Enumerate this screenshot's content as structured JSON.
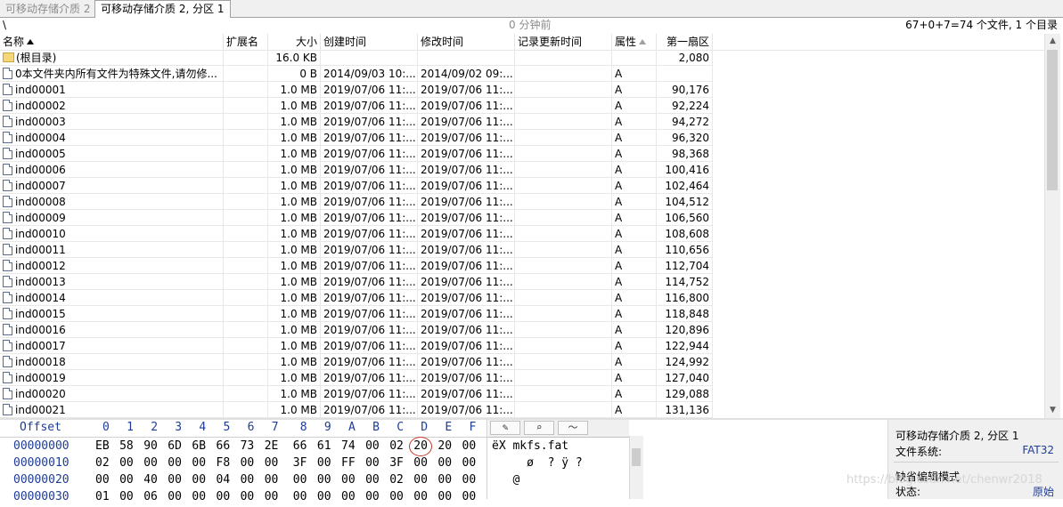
{
  "tabs": [
    {
      "label": "可移动存储介质 2",
      "active": false
    },
    {
      "label": "可移动存储介质 2, 分区 1",
      "active": true
    }
  ],
  "status": {
    "path": "\\",
    "elapsed": "0 分钟前",
    "counts": "67+0+7=74 个文件, 1 个目录"
  },
  "columns": {
    "name": "名称",
    "ext": "扩展名",
    "size": "大小",
    "created": "创建时间",
    "modified": "修改时间",
    "record_updated": "记录更新时间",
    "attr": "属性",
    "first_sector": "第一扇区"
  },
  "files": [
    {
      "type": "dir",
      "name": "(根目录)",
      "ext": "",
      "size": "16.0 KB",
      "created": "",
      "modified": "",
      "record_updated": "",
      "attr": "",
      "first_sector": "2,080"
    },
    {
      "type": "file",
      "name": "0本文件夹内所有文件为特殊文件,请勿修...",
      "ext": "",
      "size": "0 B",
      "created": "2014/09/03   10:...",
      "modified": "2014/09/02   09:...",
      "record_updated": "",
      "attr": "A",
      "first_sector": ""
    },
    {
      "type": "file",
      "name": "ind00001",
      "ext": "",
      "size": "1.0 MB",
      "created": "2019/07/06   11:...",
      "modified": "2019/07/06   11:...",
      "record_updated": "",
      "attr": "A",
      "first_sector": "90,176"
    },
    {
      "type": "file",
      "name": "ind00002",
      "ext": "",
      "size": "1.0 MB",
      "created": "2019/07/06   11:...",
      "modified": "2019/07/06   11:...",
      "record_updated": "",
      "attr": "A",
      "first_sector": "92,224"
    },
    {
      "type": "file",
      "name": "ind00003",
      "ext": "",
      "size": "1.0 MB",
      "created": "2019/07/06   11:...",
      "modified": "2019/07/06   11:...",
      "record_updated": "",
      "attr": "A",
      "first_sector": "94,272"
    },
    {
      "type": "file",
      "name": "ind00004",
      "ext": "",
      "size": "1.0 MB",
      "created": "2019/07/06   11:...",
      "modified": "2019/07/06   11:...",
      "record_updated": "",
      "attr": "A",
      "first_sector": "96,320"
    },
    {
      "type": "file",
      "name": "ind00005",
      "ext": "",
      "size": "1.0 MB",
      "created": "2019/07/06   11:...",
      "modified": "2019/07/06   11:...",
      "record_updated": "",
      "attr": "A",
      "first_sector": "98,368"
    },
    {
      "type": "file",
      "name": "ind00006",
      "ext": "",
      "size": "1.0 MB",
      "created": "2019/07/06   11:...",
      "modified": "2019/07/06   11:...",
      "record_updated": "",
      "attr": "A",
      "first_sector": "100,416"
    },
    {
      "type": "file",
      "name": "ind00007",
      "ext": "",
      "size": "1.0 MB",
      "created": "2019/07/06   11:...",
      "modified": "2019/07/06   11:...",
      "record_updated": "",
      "attr": "A",
      "first_sector": "102,464"
    },
    {
      "type": "file",
      "name": "ind00008",
      "ext": "",
      "size": "1.0 MB",
      "created": "2019/07/06   11:...",
      "modified": "2019/07/06   11:...",
      "record_updated": "",
      "attr": "A",
      "first_sector": "104,512"
    },
    {
      "type": "file",
      "name": "ind00009",
      "ext": "",
      "size": "1.0 MB",
      "created": "2019/07/06   11:...",
      "modified": "2019/07/06   11:...",
      "record_updated": "",
      "attr": "A",
      "first_sector": "106,560"
    },
    {
      "type": "file",
      "name": "ind00010",
      "ext": "",
      "size": "1.0 MB",
      "created": "2019/07/06   11:...",
      "modified": "2019/07/06   11:...",
      "record_updated": "",
      "attr": "A",
      "first_sector": "108,608"
    },
    {
      "type": "file",
      "name": "ind00011",
      "ext": "",
      "size": "1.0 MB",
      "created": "2019/07/06   11:...",
      "modified": "2019/07/06   11:...",
      "record_updated": "",
      "attr": "A",
      "first_sector": "110,656"
    },
    {
      "type": "file",
      "name": "ind00012",
      "ext": "",
      "size": "1.0 MB",
      "created": "2019/07/06   11:...",
      "modified": "2019/07/06   11:...",
      "record_updated": "",
      "attr": "A",
      "first_sector": "112,704"
    },
    {
      "type": "file",
      "name": "ind00013",
      "ext": "",
      "size": "1.0 MB",
      "created": "2019/07/06   11:...",
      "modified": "2019/07/06   11:...",
      "record_updated": "",
      "attr": "A",
      "first_sector": "114,752"
    },
    {
      "type": "file",
      "name": "ind00014",
      "ext": "",
      "size": "1.0 MB",
      "created": "2019/07/06   11:...",
      "modified": "2019/07/06   11:...",
      "record_updated": "",
      "attr": "A",
      "first_sector": "116,800"
    },
    {
      "type": "file",
      "name": "ind00015",
      "ext": "",
      "size": "1.0 MB",
      "created": "2019/07/06   11:...",
      "modified": "2019/07/06   11:...",
      "record_updated": "",
      "attr": "A",
      "first_sector": "118,848"
    },
    {
      "type": "file",
      "name": "ind00016",
      "ext": "",
      "size": "1.0 MB",
      "created": "2019/07/06   11:...",
      "modified": "2019/07/06   11:...",
      "record_updated": "",
      "attr": "A",
      "first_sector": "120,896"
    },
    {
      "type": "file",
      "name": "ind00017",
      "ext": "",
      "size": "1.0 MB",
      "created": "2019/07/06   11:...",
      "modified": "2019/07/06   11:...",
      "record_updated": "",
      "attr": "A",
      "first_sector": "122,944"
    },
    {
      "type": "file",
      "name": "ind00018",
      "ext": "",
      "size": "1.0 MB",
      "created": "2019/07/06   11:...",
      "modified": "2019/07/06   11:...",
      "record_updated": "",
      "attr": "A",
      "first_sector": "124,992"
    },
    {
      "type": "file",
      "name": "ind00019",
      "ext": "",
      "size": "1.0 MB",
      "created": "2019/07/06   11:...",
      "modified": "2019/07/06   11:...",
      "record_updated": "",
      "attr": "A",
      "first_sector": "127,040"
    },
    {
      "type": "file",
      "name": "ind00020",
      "ext": "",
      "size": "1.0 MB",
      "created": "2019/07/06   11:...",
      "modified": "2019/07/06   11:...",
      "record_updated": "",
      "attr": "A",
      "first_sector": "129,088"
    },
    {
      "type": "file",
      "name": "ind00021",
      "ext": "",
      "size": "1.0 MB",
      "created": "2019/07/06   11:...",
      "modified": "2019/07/06   11:...",
      "record_updated": "",
      "attr": "A",
      "first_sector": "131,136"
    }
  ],
  "hex": {
    "offset_label": "Offset",
    "columns": [
      "0",
      "1",
      "2",
      "3",
      "4",
      "5",
      "6",
      "7",
      "8",
      "9",
      "A",
      "B",
      "C",
      "D",
      "E",
      "F"
    ],
    "rows": [
      {
        "offset": "00000000",
        "bytes": [
          "EB",
          "58",
          "90",
          "6D",
          "6B",
          "66",
          "73",
          "2E",
          "66",
          "61",
          "74",
          "00",
          "02",
          "20",
          "20",
          "00"
        ],
        "ascii": "ëX mkfs.fat"
      },
      {
        "offset": "00000010",
        "bytes": [
          "02",
          "00",
          "00",
          "00",
          "00",
          "F8",
          "00",
          "00",
          "3F",
          "00",
          "FF",
          "00",
          "3F",
          "00",
          "00",
          "00"
        ],
        "ascii": "     ø  ? ÿ ?"
      },
      {
        "offset": "00000020",
        "bytes": [
          "00",
          "00",
          "40",
          "00",
          "00",
          "04",
          "00",
          "00",
          "00",
          "00",
          "00",
          "00",
          "02",
          "00",
          "00",
          "00"
        ],
        "ascii": "   @"
      },
      {
        "offset": "00000030",
        "bytes": [
          "01",
          "00",
          "06",
          "00",
          "00",
          "00",
          "00",
          "00",
          "00",
          "00",
          "00",
          "00",
          "00",
          "00",
          "00",
          "00"
        ],
        "ascii": ""
      }
    ],
    "highlighted": {
      "row": 0,
      "col": 13
    }
  },
  "toolbar_icons": [
    "pencil-icon",
    "search-icon",
    "graph-icon"
  ],
  "info": {
    "title": "可移动存储介质 2, 分区 1",
    "fs_label": "文件系统:",
    "fs_value": "FAT32",
    "mode_label": "缺省编辑模式",
    "state_label": "状态:",
    "state_value": "原始"
  },
  "watermark": "https://blog.csdn.net/chenwr2018"
}
